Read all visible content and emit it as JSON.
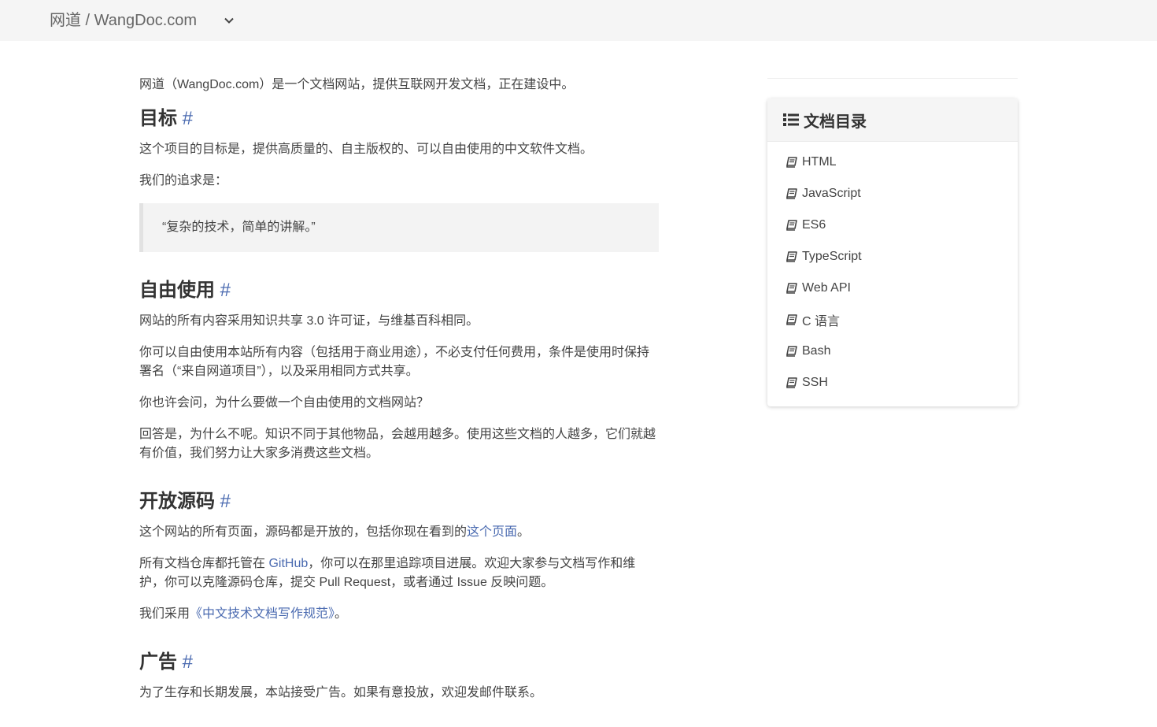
{
  "header": {
    "site_title": "网道 / WangDoc.com"
  },
  "main": {
    "intro": "网道（WangDoc.com）是一个文档网站，提供互联网开发文档，正在建设中。",
    "sections": [
      {
        "title": "目标",
        "anchor": "#",
        "p1": "这个项目的目标是，提供高质量的、自主版权的、可以自由使用的中文软件文档。",
        "p2": "我们的追求是：",
        "quote": "“复杂的技术，简单的讲解。”"
      },
      {
        "title": "自由使用",
        "anchor": "#",
        "p1": "网站的所有内容采用知识共享 3.0 许可证，与维基百科相同。",
        "p2": "你可以自由使用本站所有内容（包括用于商业用途），不必支付任何费用，条件是使用时保持署名（“来自网道项目”），以及采用相同方式共享。",
        "p3": "你也许会问，为什么要做一个自由使用的文档网站？",
        "p4": "回答是，为什么不呢。知识不同于其他物品，会越用越多。使用这些文档的人越多，它们就越有价值，我们努力让大家多消费这些文档。"
      },
      {
        "title": "开放源码",
        "anchor": "#",
        "p1_pre": "这个网站的所有页面，源码都是开放的，包括你现在看到的",
        "p1_link": "这个页面",
        "p1_post": "。",
        "p2_pre": "所有文档仓库都托管在 ",
        "p2_link": "GitHub",
        "p2_post": "，你可以在那里追踪项目进展。欢迎大家参与文档写作和维护，你可以克隆源码仓库，提交 Pull Request，或者通过 Issue 反映问题。",
        "p3_pre": "我们采用",
        "p3_link": "《中文技术文档写作规范》",
        "p3_post": "。"
      },
      {
        "title": "广告",
        "anchor": "#",
        "p1": "为了生存和长期发展，本站接受广告。如果有意投放，欢迎发邮件联系。"
      }
    ]
  },
  "toc": {
    "title": "文档目录",
    "icon": "list-icon",
    "item_icon": "book-icon",
    "items": [
      {
        "label": "HTML"
      },
      {
        "label": "JavaScript"
      },
      {
        "label": "ES6"
      },
      {
        "label": "TypeScript"
      },
      {
        "label": "Web API"
      },
      {
        "label": "C 语言"
      },
      {
        "label": "Bash"
      },
      {
        "label": "SSH"
      }
    ]
  },
  "colors": {
    "link": "#4a6ab0",
    "text": "#444444",
    "topbar_bg": "#f5f5f5"
  }
}
